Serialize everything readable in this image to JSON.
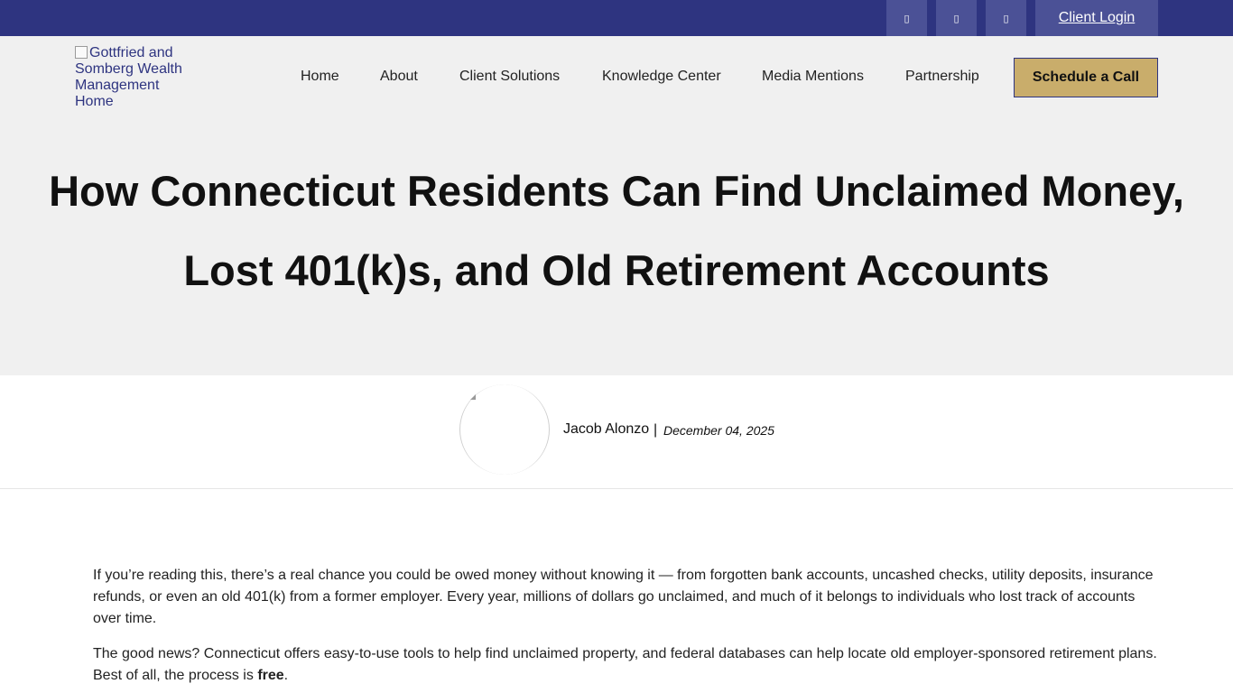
{
  "topbar": {
    "social_icons": [
      {
        "name": "social-icon-1",
        "glyph": "▯"
      },
      {
        "name": "social-icon-2",
        "glyph": "▯"
      },
      {
        "name": "social-icon-3",
        "glyph": "▯"
      }
    ],
    "client_login": "Client Login",
    "background_color": "#2e3480",
    "icon_background_color": "#4b5196"
  },
  "header": {
    "logo_alt": "Gottfried and Somberg Wealth Management Home",
    "nav": [
      "Home",
      "About",
      "Client Solutions",
      "Knowledge Center",
      "Media Mentions",
      "Partnership"
    ],
    "cta": "Schedule a Call",
    "cta_color": "#c9ad6b",
    "background_color": "#f0f0f0"
  },
  "article": {
    "title": "How Connecticut Residents Can Find Unclaimed Money, Lost 401(k)s, and Old Retirement Accounts",
    "author": "Jacob Alonzo",
    "separator": "|",
    "date": "December 04, 2025",
    "paragraph1": "If you’re reading this, there’s a real chance you could be owed money without knowing it — from forgotten bank accounts, uncashed checks, utility deposits, insurance refunds, or even an old 401(k) from a former employer. Every year, millions of dollars go unclaimed, and much of it belongs to individuals who lost track of accounts over time.",
    "paragraph2_text": "The good news? Connecticut offers easy-to-use tools to help find unclaimed property, and federal databases can help locate old employer-sponsored retirement plans. Best of all, the process is ",
    "paragraph2_bold": "free",
    "paragraph2_end": "."
  }
}
